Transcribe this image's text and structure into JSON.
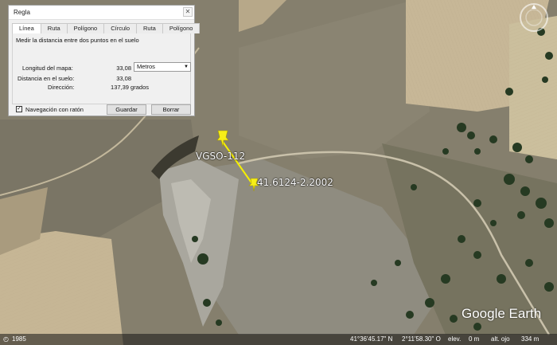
{
  "dialog": {
    "title": "Regla",
    "tabs": [
      "Línea",
      "Ruta",
      "Polígono",
      "Círculo",
      "Ruta 3D",
      "Polígono 3D"
    ],
    "description": "Medir la distancia entre dos puntos en el suelo",
    "map_length_label": "Longitud del mapa:",
    "map_length_value": "33,08",
    "units_selected": "Metros",
    "ground_distance_label": "Distancia en el suelo:",
    "ground_distance_value": "33,08",
    "direction_label": "Dirección:",
    "direction_value": "137,39 grados",
    "navigation_label": "Navegación con ratón",
    "navigation_checked": true,
    "save_label": "Guardar",
    "clear_label": "Borrar"
  },
  "map": {
    "placemark_1": "VGSO-112",
    "placemark_2": "41.6124-2.2002",
    "ruler_color": "#f5ef00",
    "pin_color": "#f7ee18"
  },
  "brand": {
    "logo_text": "Google Earth"
  },
  "status": {
    "imagery_year": "1985",
    "latitude": "41°36'45.17\" N",
    "longitude": "2°11'58.30\" O",
    "elevation_label": "elev.",
    "elevation_value": "0 m",
    "eye_alt_label": "alt. ojo",
    "eye_alt_value": "334 m"
  }
}
